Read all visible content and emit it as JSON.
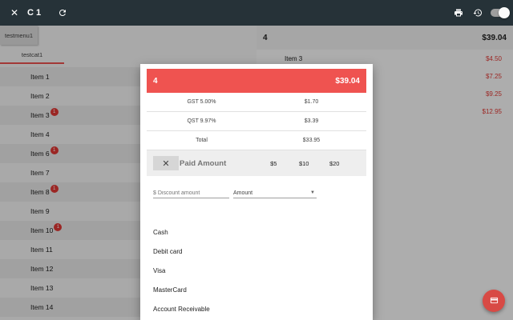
{
  "topbar": {
    "title": "C1",
    "close_icon": "close-icon",
    "refresh_icon": "refresh-icon",
    "print_icon": "print-icon",
    "history_icon": "history-icon",
    "toggle_state": "off",
    "background": "#263238"
  },
  "menu": {
    "tab_label": "testmenu1",
    "category_label": "testcat1"
  },
  "items": [
    {
      "label": "Item 1",
      "badge": ""
    },
    {
      "label": "Item 2",
      "badge": ""
    },
    {
      "label": "Item 3",
      "badge": "1"
    },
    {
      "label": "Item 4",
      "badge": ""
    },
    {
      "label": "Item 6",
      "badge": "1"
    },
    {
      "label": "Item 7",
      "badge": ""
    },
    {
      "label": "Item 8",
      "badge": "1"
    },
    {
      "label": "Item 9",
      "badge": ""
    },
    {
      "label": "Item 10",
      "badge": "1"
    },
    {
      "label": "Item 11",
      "badge": ""
    },
    {
      "label": "Item 12",
      "badge": ""
    },
    {
      "label": "Item 13",
      "badge": ""
    },
    {
      "label": "Item 14",
      "badge": ""
    }
  ],
  "order": {
    "count": "4",
    "total": "$39.04",
    "lines": [
      {
        "label": "Item 3",
        "price": "$4.50"
      },
      {
        "label": "",
        "price": "$7.25"
      },
      {
        "label": "",
        "price": "$9.25"
      },
      {
        "label": "",
        "price": "$12.95"
      }
    ]
  },
  "dialog": {
    "count": "4",
    "total": "$39.04",
    "accent": "#ef5350",
    "taxes": [
      {
        "label": "GST 5.00%",
        "amount": "$1.70"
      },
      {
        "label": "QST 9.97%",
        "amount": "$3.39"
      },
      {
        "label": "Total",
        "amount": "$33.95"
      }
    ],
    "paid_label": "Paid Amount",
    "quick_amounts": [
      "$5",
      "$10",
      "$20"
    ],
    "discount_placeholder": "$ Discount amount",
    "discount_type": "Amount",
    "payment_methods": [
      "Cash",
      "Debit card",
      "Visa",
      "MasterCard",
      "Account Receivable"
    ]
  },
  "fab": {
    "icon": "credit-card-icon",
    "color": "#d84a45"
  }
}
